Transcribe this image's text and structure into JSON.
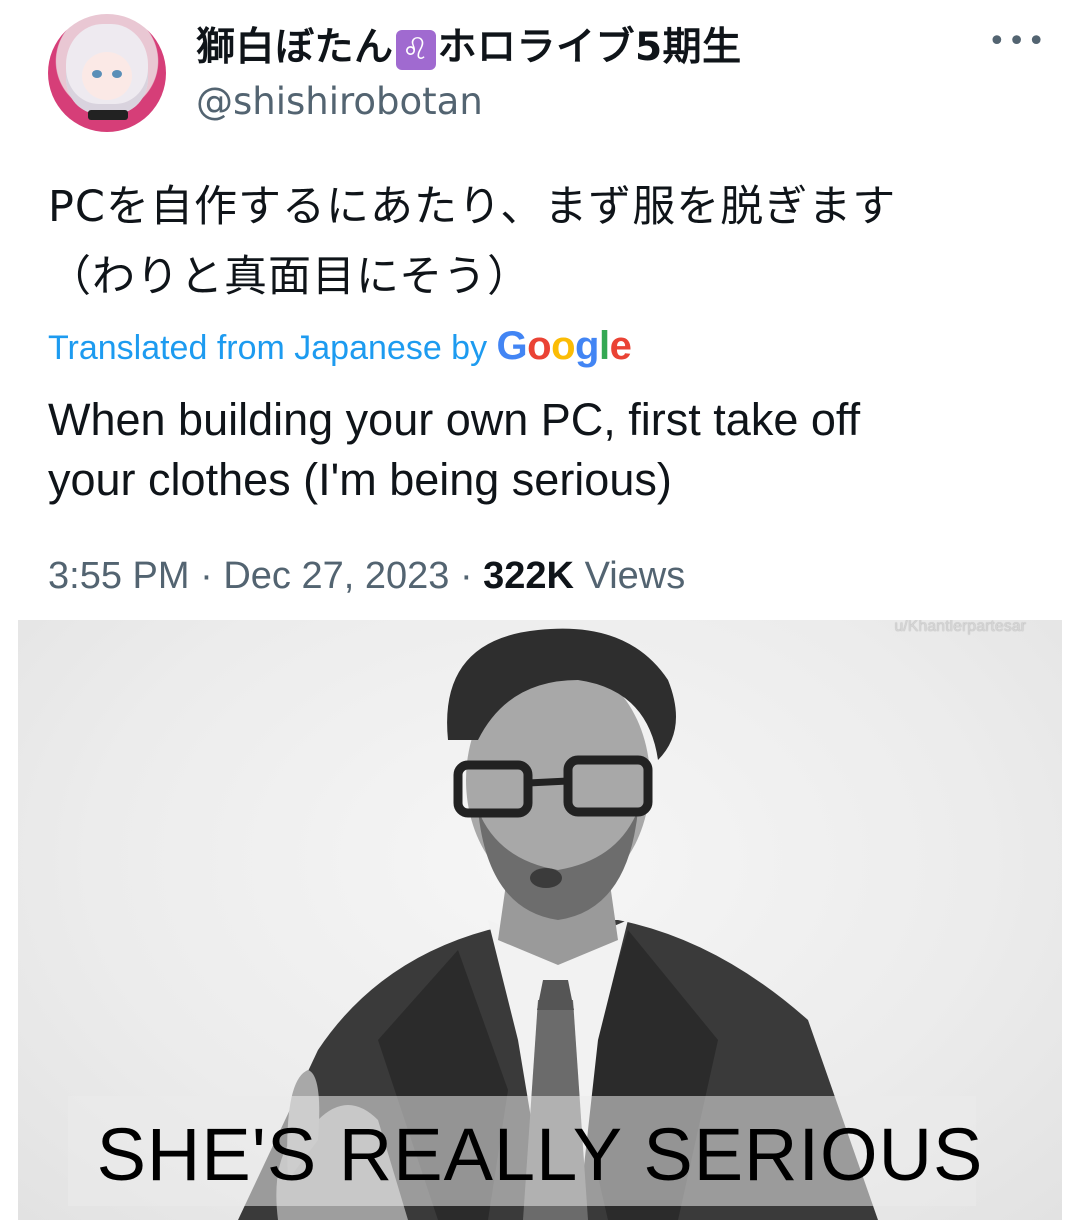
{
  "tweet": {
    "display_name": {
      "before_badge": "獅白ぼたん",
      "badge_symbol": "♌",
      "after_badge": "ホロライブ5期生"
    },
    "handle": "@shishirobotan",
    "more_icon": "more-horizontal-icon",
    "more_label": "•••",
    "text_line_1": "PCを自作するにあたり、まず服を脱ぎます",
    "text_line_2": "（わりと真面目にそう）",
    "translated_label": "Translated from Japanese by",
    "google_letters": [
      "G",
      "o",
      "o",
      "g",
      "l",
      "e"
    ],
    "translation_line_1": "When building your own PC, first take off",
    "translation_line_2": "your clothes (I'm being serious)",
    "time": "3:55 PM",
    "separator": "·",
    "date": "Dec 27, 2023",
    "views_count": "322K",
    "views_label": "Views"
  },
  "meme": {
    "watermark": "u/Khantlerpartesar",
    "caption": "SHE'S REALLY SERIOUS"
  },
  "colors": {
    "link_blue": "#1d9bf0",
    "secondary_text": "#536471",
    "badge_purple": "#a06ad0"
  }
}
